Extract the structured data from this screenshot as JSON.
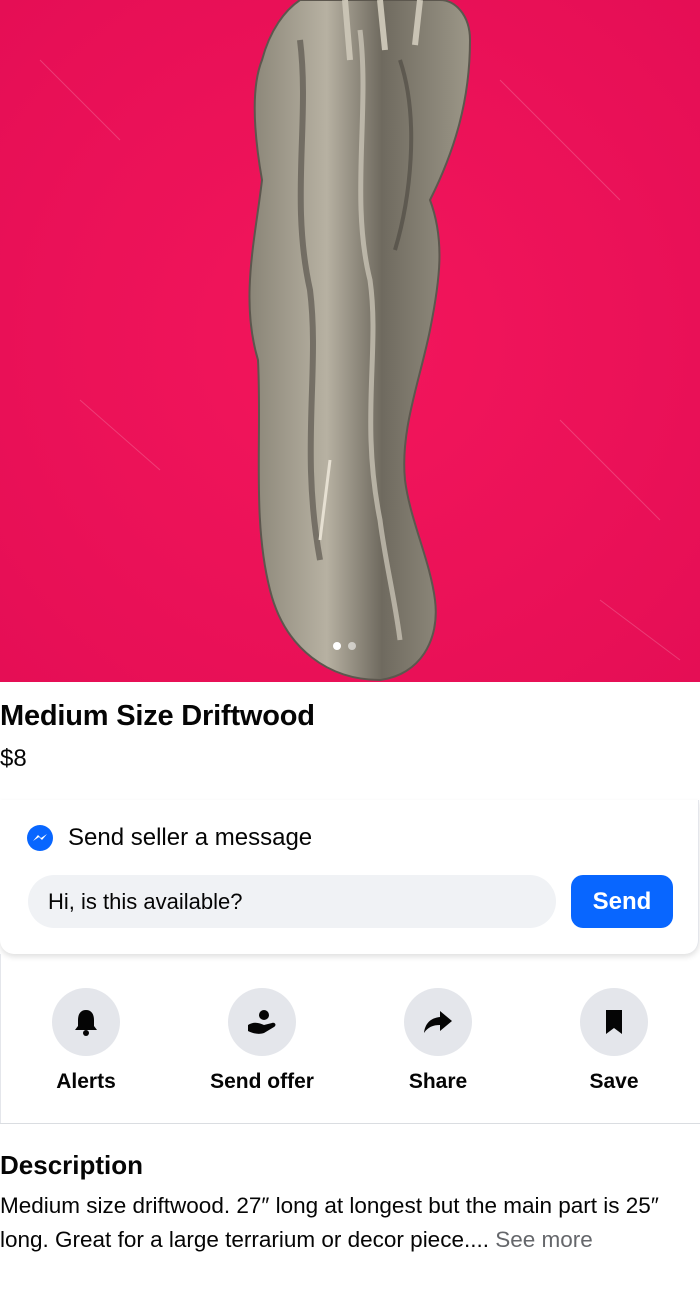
{
  "listing": {
    "title": "Medium Size Driftwood",
    "price": "$8",
    "image_alt": "Driftwood on red towel",
    "photo_count": 2,
    "active_photo": 1
  },
  "message": {
    "heading": "Send seller a message",
    "input_value": "Hi, is this available?",
    "send_label": "Send",
    "icon": "messenger-icon"
  },
  "actions": [
    {
      "label": "Alerts",
      "icon": "bell-icon"
    },
    {
      "label": "Send offer",
      "icon": "offer-icon"
    },
    {
      "label": "Share",
      "icon": "share-arrow-icon"
    },
    {
      "label": "Save",
      "icon": "bookmark-icon"
    }
  ],
  "description": {
    "heading": "Description",
    "text": "Medium size driftwood. 27″ long at longest but the main part is 25″ long. Great for a large terrarium or decor piece.... ",
    "see_more": "See more"
  },
  "colors": {
    "accent": "#0866ff",
    "photo_bg": "#f0145a",
    "button_bg": "#e4e6eb",
    "input_bg": "#f0f2f5"
  }
}
